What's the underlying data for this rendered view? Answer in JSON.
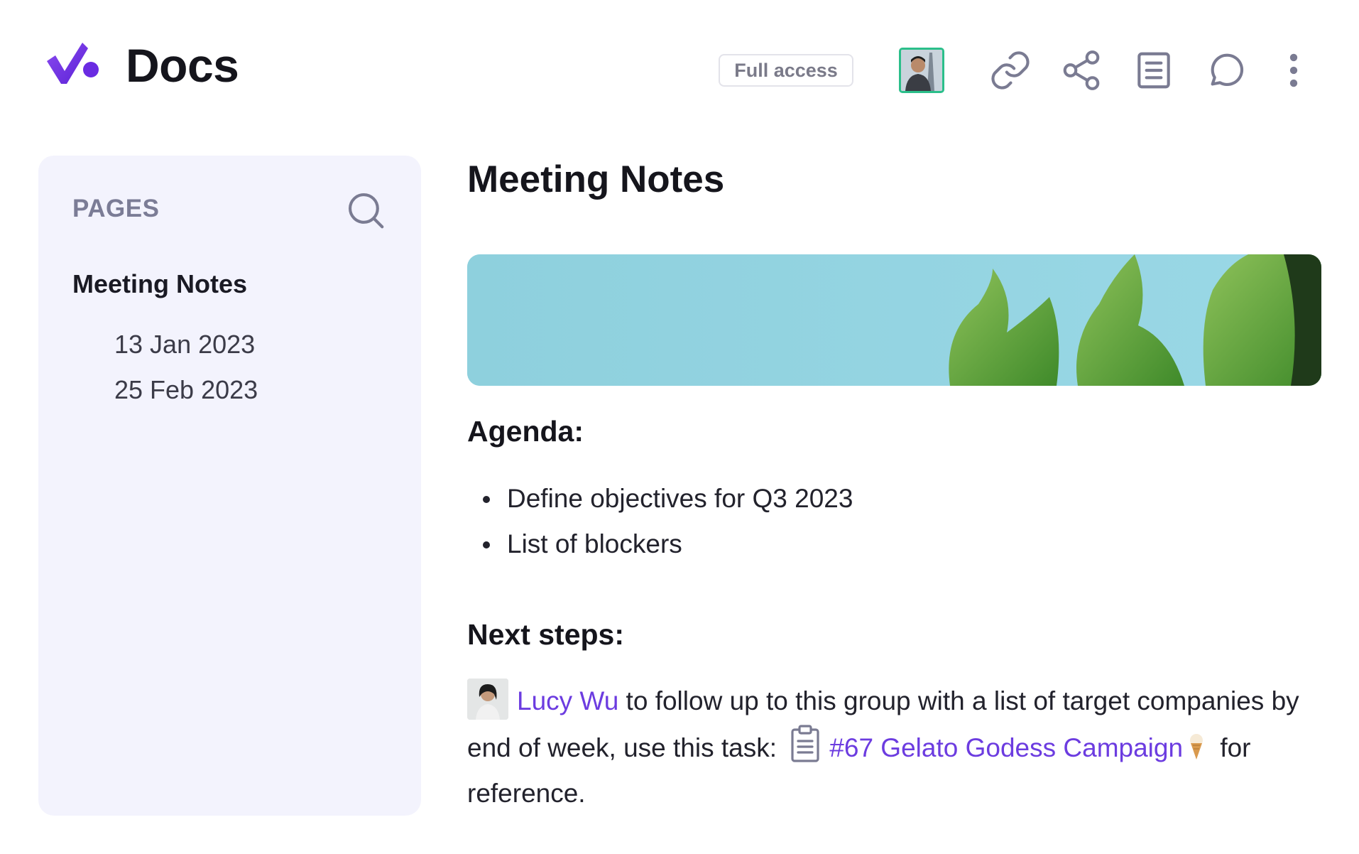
{
  "header": {
    "app_title": "Docs",
    "access_label": "Full access",
    "logo_icon": "docs-logo-icon",
    "icons": [
      "link-icon",
      "share-icon",
      "document-list-icon",
      "comment-icon",
      "more-vertical-icon"
    ]
  },
  "sidebar": {
    "heading": "PAGES",
    "search_icon": "search-icon",
    "pages": [
      {
        "label": "Meeting Notes",
        "children": [
          {
            "label": "13 Jan 2023"
          },
          {
            "label": "25 Feb 2023"
          }
        ]
      }
    ]
  },
  "document": {
    "title": "Meeting Notes",
    "cover": "cactus-cover-image",
    "agenda": {
      "heading": "Agenda:",
      "items": [
        "Define objectives for Q3 2023",
        "List of blockers"
      ]
    },
    "next_steps": {
      "heading": "Next steps:",
      "mention_name": "Lucy Wu",
      "text_1": " to follow up to this group with a list of target companies by end of week, use this task: ",
      "task_link": "#67 Gelato Godess Campaign",
      "text_2": " for reference."
    }
  },
  "colors": {
    "accent": "#6c3ce0",
    "sidebar_bg": "#f3f3fd",
    "avatar_border": "#2bbf8a",
    "icon_color": "#7a7b92"
  }
}
